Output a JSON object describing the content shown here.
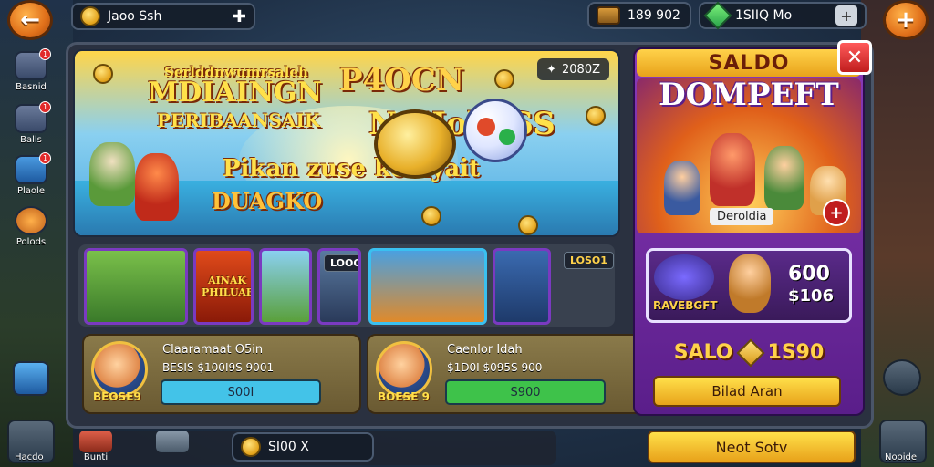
{
  "topbar": {
    "back_icon": "arrow-left-icon",
    "player_label": "Jaoo Ssh",
    "add_icon": "plus-icon",
    "coins_value": "189 902",
    "gems_value": "1",
    "gems_text": "1SIIQ Mo",
    "add_currency_label": "+",
    "plus_button_label": "+"
  },
  "sidebar": {
    "items": [
      {
        "label": "Basnid",
        "badge": "1",
        "icon": "card-icon"
      },
      {
        "label": "Balls",
        "badge": "1",
        "icon": "book-icon"
      },
      {
        "label": "Plaole",
        "badge": "1",
        "icon": "box-icon"
      },
      {
        "label": "Polods",
        "badge": "",
        "icon": "character-icon"
      }
    ]
  },
  "banner": {
    "line1": "Serlddnwumrsaleh",
    "line2": "MDIAINGN",
    "line3": "PERIBAANSAIK",
    "headline_a": "P4OCN",
    "headline_b": "NaHolloSS",
    "subtitle": "Pikan zuse kemyait",
    "subtitle2": "DUAGKO",
    "timer": "2080Z",
    "timer_icon": "clock-icon"
  },
  "thumbs": {
    "labels": [
      "AINAK PHILUABN",
      "LOOON",
      "LOSO1"
    ]
  },
  "cards": [
    {
      "name": "Claaramaat O5in",
      "sub": "BESIS $100I9S 9001",
      "badge": "BEOSE9",
      "button": "S00I",
      "button_color": "#43c3e8"
    },
    {
      "name": "Caenlor Idah",
      "sub": "$1D0I $095S 900",
      "badge": "BOESE 9",
      "button": "S900",
      "button_color": "#3ec24a"
    }
  ],
  "side_panel": {
    "header": "SALDO",
    "title": "DOMPEFT",
    "close_label": "✕",
    "badge": "Deroldia",
    "plus_label": "+",
    "offer_label": "RAVEBGFT",
    "offer_value1": "600",
    "offer_value2": "$106",
    "saldo_prefix": "SALO",
    "saldo_value": "1S90",
    "button": "Bilad Aran"
  },
  "bottom": {
    "items": [
      {
        "label": "Hacdo",
        "icon": "hammer-icon"
      },
      {
        "label": "Bunti",
        "icon": "pencil-icon"
      },
      {
        "label": "",
        "icon": "crate-icon"
      }
    ],
    "coin_text": "SI00 X",
    "next_button": "Neot Sotv",
    "right_label": "Nooide"
  }
}
